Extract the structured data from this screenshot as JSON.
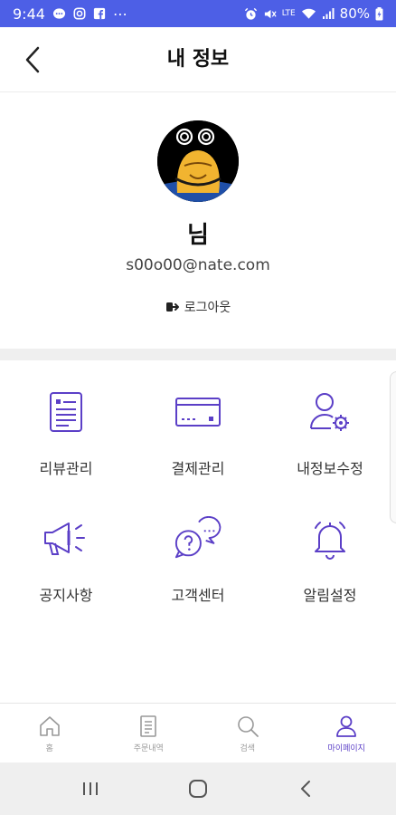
{
  "status_bar": {
    "time": "9:44",
    "battery": "80%",
    "left_icons": [
      "chat-icon",
      "instagram-icon",
      "facebook-icon",
      "more-dots"
    ],
    "right_icons": [
      "alarm-icon",
      "mute-icon",
      "volte-icon",
      "wifi-icon",
      "signal-icon",
      "battery-icon"
    ]
  },
  "header": {
    "title": "내 정보",
    "back_icon": "chevron-left-icon"
  },
  "profile": {
    "name": "님",
    "email": "s00o00@nate.com",
    "logout_label": "로그아웃",
    "logout_icon": "logout-icon"
  },
  "menu": [
    {
      "label": "리뷰관리",
      "icon": "review-doc-icon"
    },
    {
      "label": "결제관리",
      "icon": "credit-card-icon"
    },
    {
      "label": "내정보수정",
      "icon": "user-settings-icon"
    },
    {
      "label": "공지사항",
      "icon": "megaphone-icon"
    },
    {
      "label": "고객센터",
      "icon": "chat-bubbles-icon"
    },
    {
      "label": "알림설정",
      "icon": "bell-icon"
    }
  ],
  "bottom_nav": [
    {
      "label": "홈",
      "icon": "home-icon",
      "active": false
    },
    {
      "label": "주문내역",
      "icon": "receipt-icon",
      "active": false
    },
    {
      "label": "검색",
      "icon": "search-icon",
      "active": false
    },
    {
      "label": "마이페이지",
      "icon": "user-icon",
      "active": true
    }
  ],
  "colors": {
    "status_bar": "#4d5fe6",
    "accent": "#5b3fc7",
    "inactive": "#999999"
  }
}
